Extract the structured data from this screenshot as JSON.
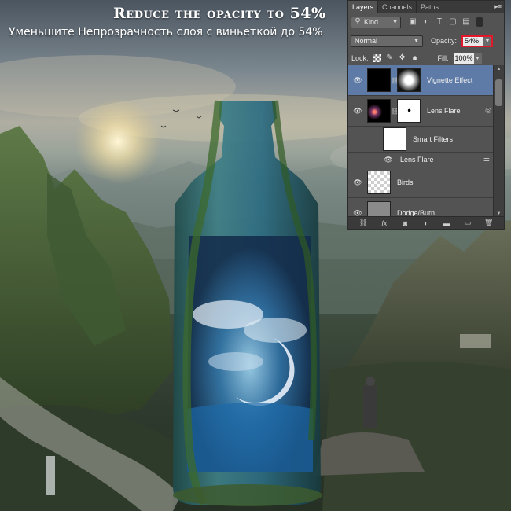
{
  "heading": {
    "english": "Reduce the opacity to 54%",
    "russian": "Уменьшите Непрозрачность слоя с виньеткой до 54%"
  },
  "panel": {
    "tabs": [
      {
        "label": "Layers",
        "active": true
      },
      {
        "label": "Channels",
        "active": false
      },
      {
        "label": "Paths",
        "active": false
      }
    ],
    "menu_icon": "panel-menu-icon",
    "filter_kind": "Kind",
    "filter_icons": [
      "pixel-filter-icon",
      "adjustment-filter-icon",
      "type-filter-icon",
      "shape-filter-icon",
      "smart-object-filter-icon"
    ],
    "blend_mode": "Normal",
    "opacity_label": "Opacity:",
    "opacity_value": "54%",
    "lock_label": "Lock:",
    "lock_icons": [
      "lock-transparent-icon",
      "lock-image-icon",
      "lock-position-icon",
      "lock-all-icon"
    ],
    "fill_label": "Fill:",
    "fill_value": "100%",
    "layers": [
      {
        "name": "Vignette Effect",
        "selected": true
      },
      {
        "name": "Lens Flare",
        "selected": false
      },
      {
        "name": "Smart Filters",
        "selected": false
      },
      {
        "name": "Lens Flare",
        "selected": false
      },
      {
        "name": "Birds",
        "selected": false
      },
      {
        "name": "Dodge/Burn",
        "selected": false
      }
    ],
    "bottom_icons": [
      "link-layers-icon",
      "add-style-icon",
      "add-mask-icon",
      "new-adjustment-icon",
      "new-group-icon",
      "new-layer-icon",
      "delete-layer-icon"
    ],
    "colors": {
      "panel_bg": "#535353",
      "selected_row": "#5d7ba6",
      "highlight_border": "#e0182a"
    }
  }
}
